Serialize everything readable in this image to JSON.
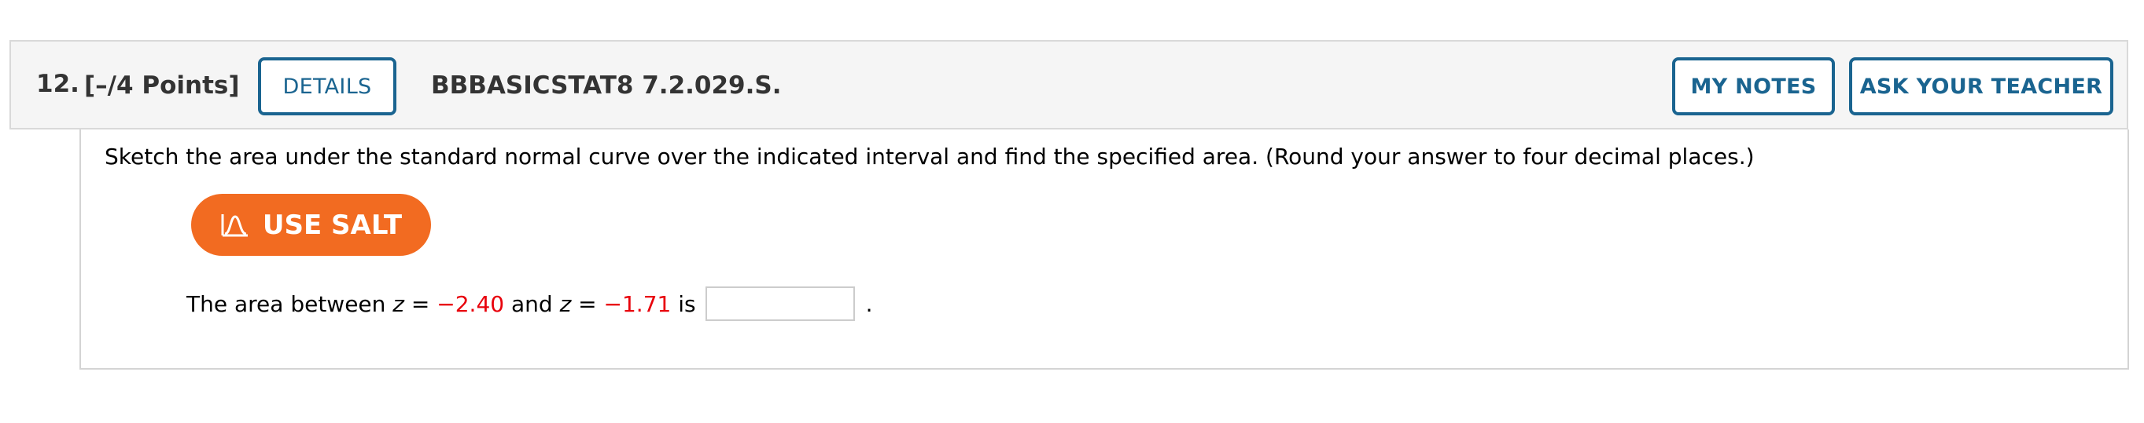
{
  "question": {
    "number": "12.",
    "points": "[–/4 Points]",
    "details_label": "DETAILS",
    "code": "BBBASICSTAT8 7.2.029.S.",
    "my_notes_label": "MY NOTES",
    "ask_teacher_label": "ASK YOUR TEACHER"
  },
  "content": {
    "instructions": "Sketch the area under the standard normal curve over the indicated interval and find the specified area. (Round your answer to four decimal places.)",
    "salt_label": "USE SALT",
    "salt_icon": "normal-curve-icon",
    "answer": {
      "prefix": "The area between ",
      "var1": "z",
      "eq1": " = ",
      "value1": "−2.40",
      "mid": " and ",
      "var2": "z",
      "eq2": " = ",
      "value2": "−1.71",
      "suffix": " is",
      "input_value": "",
      "period": "."
    }
  },
  "colors": {
    "accent_blue": "#1a6490",
    "salt_orange": "#f26b21",
    "value_red": "#e8000b"
  }
}
